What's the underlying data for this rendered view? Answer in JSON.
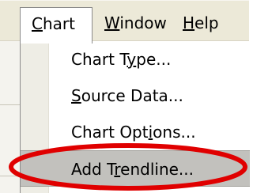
{
  "menubar": {
    "items": [
      {
        "label_prefix": "",
        "mnemonic": "C",
        "label_suffix": "hart",
        "active": true
      },
      {
        "label_prefix": "",
        "mnemonic": "W",
        "label_suffix": "indow",
        "active": false
      },
      {
        "label_prefix": "",
        "mnemonic": "H",
        "label_suffix": "elp",
        "active": false
      }
    ]
  },
  "chart_menu": {
    "items": [
      {
        "label_prefix": "Chart T",
        "mnemonic": "y",
        "label_suffix": "pe..."
      },
      {
        "label_prefix": "",
        "mnemonic": "S",
        "label_suffix": "ource Data..."
      },
      {
        "label_prefix": "Chart Opt",
        "mnemonic": "i",
        "label_suffix": "ons..."
      },
      {
        "label_prefix": "Add T",
        "mnemonic": "r",
        "label_suffix": "endline...",
        "highlighted": true
      }
    ]
  },
  "colors": {
    "annotation_ring": "#e00000",
    "highlight": "#c2c1bd",
    "menubar": "#ece9d8"
  }
}
